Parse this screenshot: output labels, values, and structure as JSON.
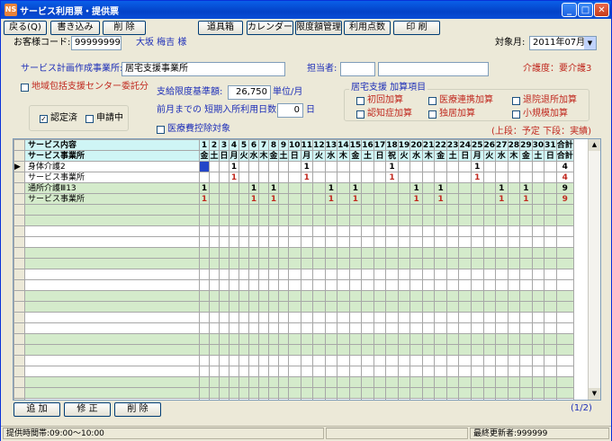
{
  "window": {
    "title": "サービス利用票・提供票",
    "icon_text": "NS"
  },
  "toolbar": {
    "back": "戻る(Q)",
    "write": "書き込み",
    "delete": "削 除",
    "tools": "道具箱",
    "calendar": "カレンダー",
    "limit": "限度額管理",
    "points": "利用点数",
    "print": "印 刷"
  },
  "customer": {
    "code_label": "お客様コード:",
    "code": "99999999",
    "name": "大坂 梅吉 様",
    "target_label": "対象月:",
    "target_month": "2011年07月"
  },
  "plan": {
    "office_label": "サービス計画作成事業所:",
    "office": "居宅支援事業所",
    "staff_label": "担当者:",
    "care_level": "介護度：要介護3",
    "community_label": "地域包括支援センター委託分",
    "limit_label": "支給限度基準額:",
    "limit_value": "26,750",
    "limit_unit": "単位/月",
    "shortstay_label": "前月までの 短期入所利用日数:",
    "shortstay_value": "0",
    "shortstay_unit": "日",
    "medical_label": "医療費控除対象",
    "certified_label": "認定済",
    "applying_label": "申請中"
  },
  "addons": {
    "title": "居宅支援 加算項目",
    "items": [
      "初回加算",
      "医療連携加算",
      "退院退所加算",
      "認知症加算",
      "独居加算",
      "小規模加算"
    ]
  },
  "legend": "(上段：予定  下段：実績)",
  "grid": {
    "hdr1": "サービス内容",
    "hdr2": "サービス事業所",
    "total_label": "合計",
    "weekdays": [
      "金",
      "土",
      "日",
      "月",
      "火",
      "水",
      "木",
      "金",
      "土",
      "日",
      "月",
      "火",
      "水",
      "木",
      "金",
      "土",
      "日",
      "祝",
      "火",
      "水",
      "木",
      "金",
      "土",
      "日",
      "月",
      "火",
      "水",
      "木",
      "金",
      "土",
      "日"
    ],
    "rows": [
      {
        "label": "身体介護2",
        "green": false,
        "first_selected": true,
        "red": false,
        "marks": [
          4,
          11,
          18,
          25
        ],
        "total": "4"
      },
      {
        "label": "サービス事業所",
        "green": false,
        "first_selected": false,
        "red": true,
        "marks": [
          4,
          11,
          18,
          25
        ],
        "total": "4"
      },
      {
        "label": "通所介護Ⅲ13",
        "green": true,
        "first_selected": false,
        "red": false,
        "marks": [
          1,
          6,
          8,
          13,
          15,
          20,
          22,
          27,
          29
        ],
        "total": "9"
      },
      {
        "label": "サービス事業所",
        "green": true,
        "first_selected": false,
        "red": true,
        "marks": [
          1,
          6,
          8,
          13,
          15,
          20,
          22,
          27,
          29
        ],
        "total": "9"
      }
    ],
    "empty_row_count": 20
  },
  "bottom": {
    "add": "追 加",
    "edit": "修 正",
    "delete": "削 除",
    "page": "(1/2)"
  },
  "status": {
    "time": "提供時間帯:09:00～10:00",
    "updater": "最終更新者:999999"
  },
  "colors": {
    "header_cyan": "#CFF5F5",
    "row_green": "#D4EBCB",
    "red_text": "#C0281E",
    "blue_text": "#1E2FB8"
  }
}
